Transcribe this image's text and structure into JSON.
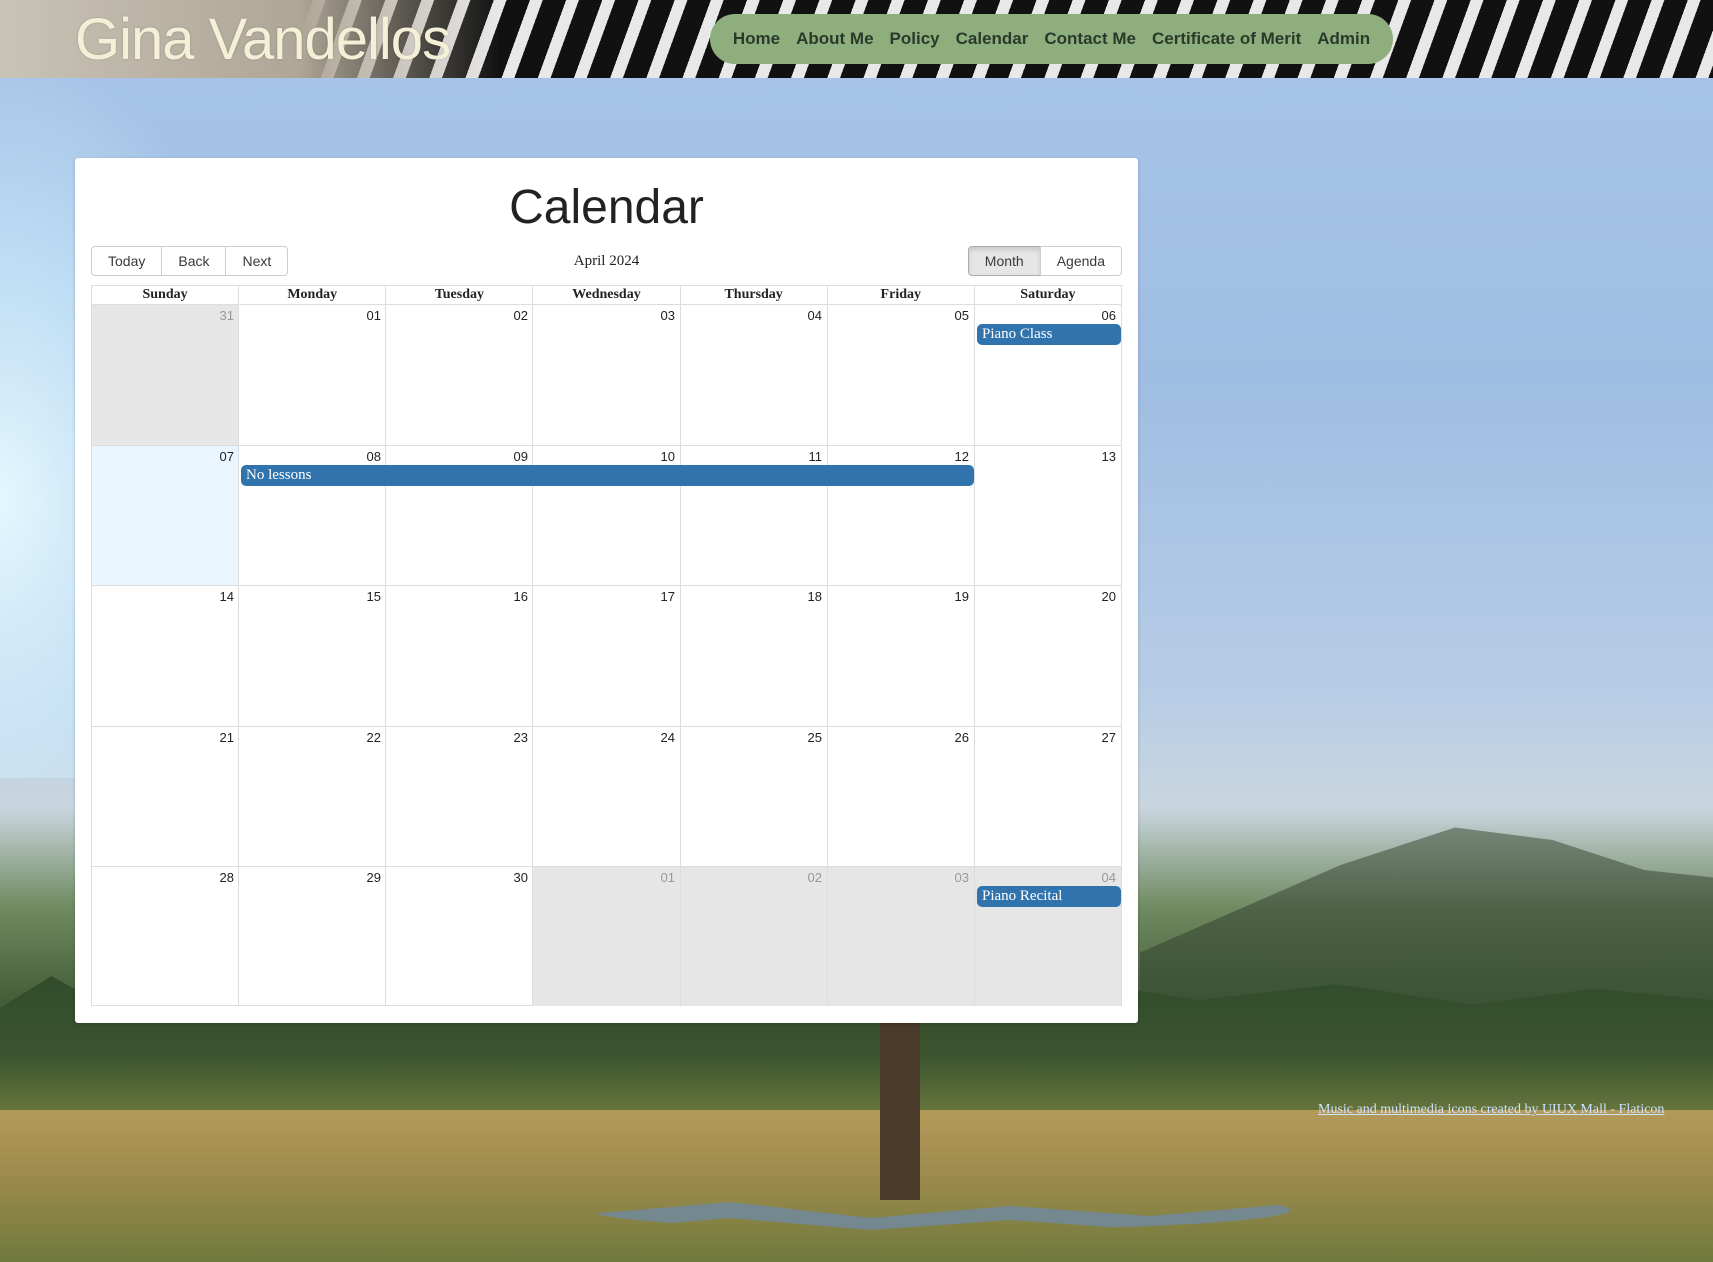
{
  "site": {
    "title": "Gina Vandellos"
  },
  "nav": {
    "items": [
      "Home",
      "About Me",
      "Policy",
      "Calendar",
      "Contact Me",
      "Certificate of Merit",
      "Admin"
    ]
  },
  "calendar": {
    "heading": "Calendar",
    "toolbar": {
      "today_label": "Today",
      "back_label": "Back",
      "next_label": "Next",
      "period_label": "April 2024",
      "month_label": "Month",
      "agenda_label": "Agenda",
      "active_view": "Month"
    },
    "weekdays": [
      "Sunday",
      "Monday",
      "Tuesday",
      "Wednesday",
      "Thursday",
      "Friday",
      "Saturday"
    ],
    "weeks": [
      [
        "31",
        "01",
        "02",
        "03",
        "04",
        "05",
        "06"
      ],
      [
        "07",
        "08",
        "09",
        "10",
        "11",
        "12",
        "13"
      ],
      [
        "14",
        "15",
        "16",
        "17",
        "18",
        "19",
        "20"
      ],
      [
        "21",
        "22",
        "23",
        "24",
        "25",
        "26",
        "27"
      ],
      [
        "28",
        "29",
        "30",
        "01",
        "02",
        "03",
        "04"
      ]
    ],
    "events": {
      "piano_class": "Piano Class",
      "no_lessons": "No lessons",
      "piano_recital": "Piano Recital"
    },
    "colors": {
      "event": "#3174ad",
      "off_range": "#e6e6e6",
      "today": "#eaf6ff"
    }
  },
  "footer": {
    "credit": "Music and multimedia icons created by UIUX Mall - Flaticon"
  }
}
